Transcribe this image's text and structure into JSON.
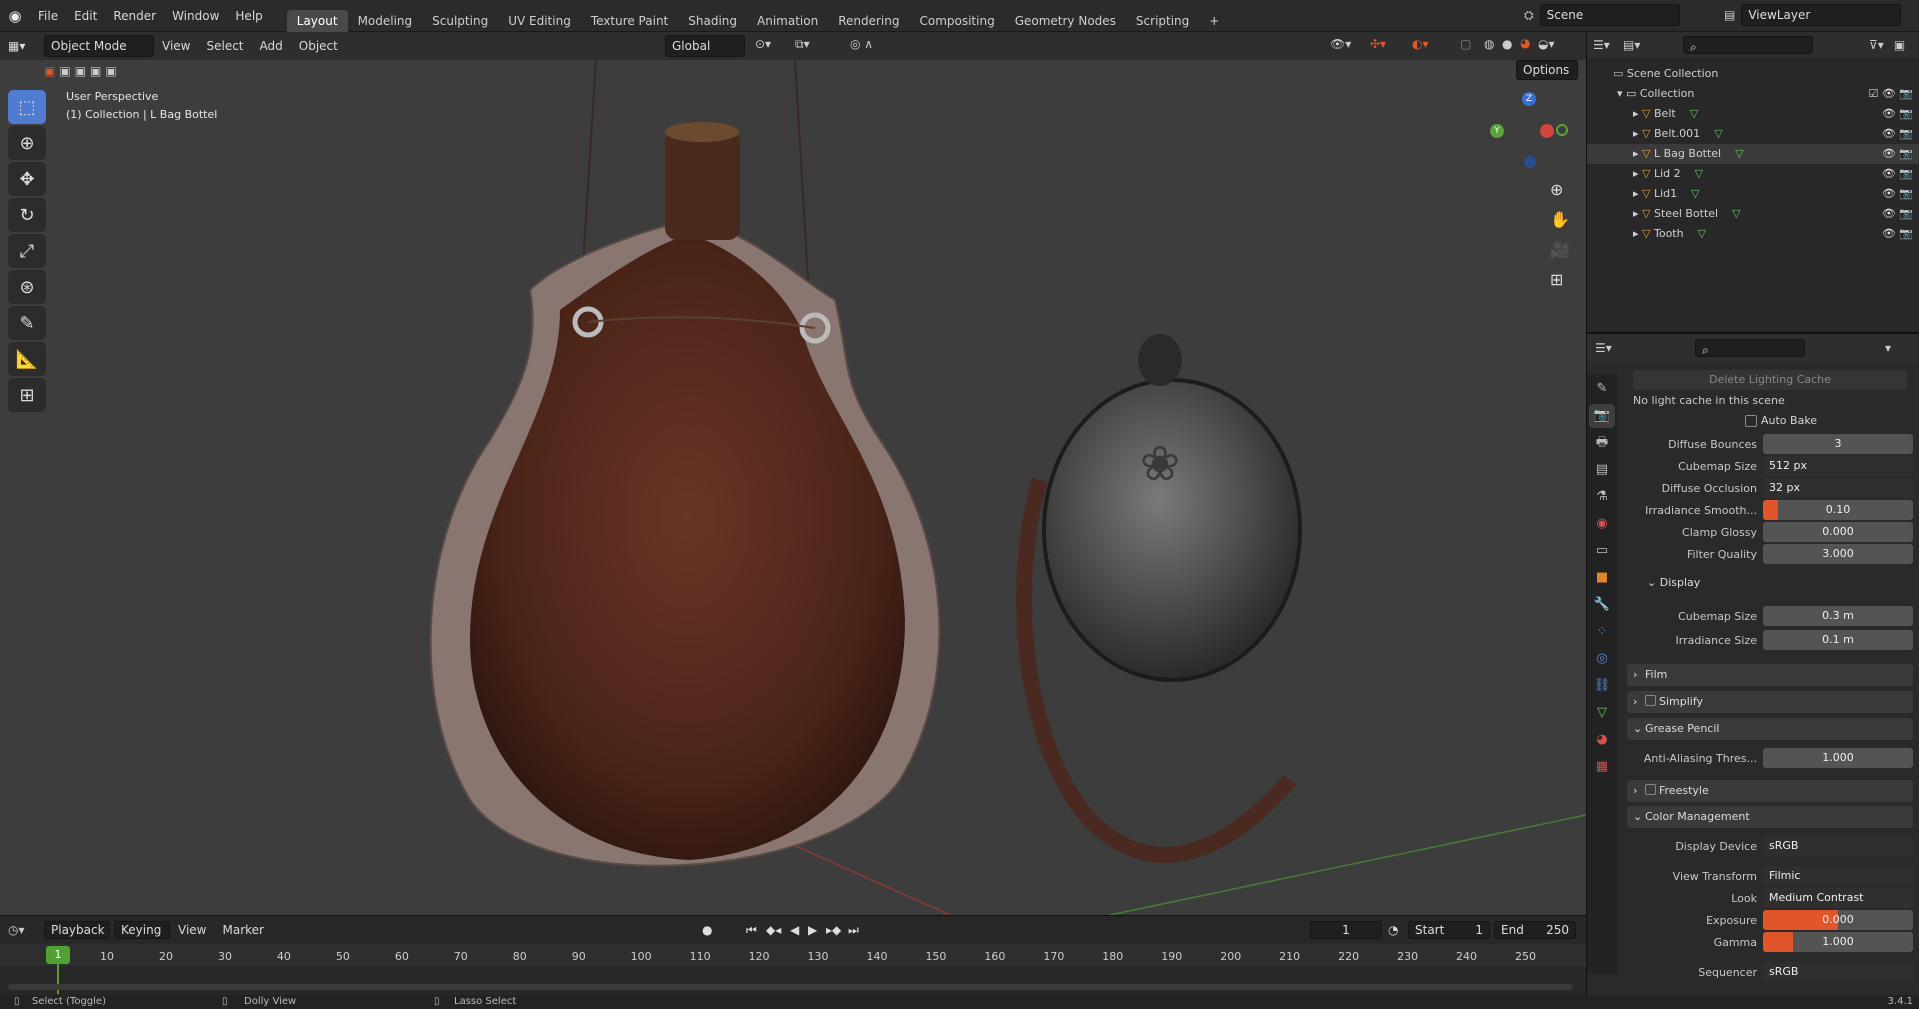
{
  "topbar": {
    "menus": [
      "File",
      "Edit",
      "Render",
      "Window",
      "Help"
    ],
    "workspaces": [
      "Layout",
      "Modeling",
      "Sculpting",
      "UV Editing",
      "Texture Paint",
      "Shading",
      "Animation",
      "Rendering",
      "Compositing",
      "Geometry Nodes",
      "Scripting"
    ],
    "active_workspace": "Layout",
    "scene": "Scene",
    "view_layer": "ViewLayer"
  },
  "viewport_header": {
    "mode": "Object Mode",
    "menus": [
      "View",
      "Select",
      "Add",
      "Object"
    ],
    "orientation": "Global",
    "options": "Options"
  },
  "viewport": {
    "perspective": "User Perspective",
    "collection_info": "(1) Collection | L Bag Bottel",
    "gizmo": {
      "z": "Z",
      "y": "Y"
    }
  },
  "outliner": {
    "root": "Scene Collection",
    "collection": "Collection",
    "items": [
      "Belt",
      "Belt.001",
      "L Bag Bottel",
      "Lid 2",
      "Lid1",
      "Steel Bottel",
      "Tooth"
    ]
  },
  "properties": {
    "delete_cache": "Delete Lighting Cache",
    "no_cache": "No light cache in this scene",
    "auto_bake": "Auto Bake",
    "fields": [
      {
        "label": "Diffuse Bounces",
        "value": "3"
      },
      {
        "label": "Cubemap Size",
        "value": "512 px"
      },
      {
        "label": "Diffuse Occlusion",
        "value": "32 px"
      },
      {
        "label": "Irradiance Smooth...",
        "value": "0.10"
      },
      {
        "label": "Clamp Glossy",
        "value": "0.000"
      },
      {
        "label": "Filter Quality",
        "value": "3.000"
      }
    ],
    "display_panel": "Display",
    "display_fields": [
      {
        "label": "Cubemap Size",
        "value": "0.3 m"
      },
      {
        "label": "Irradiance Size",
        "value": "0.1 m"
      }
    ],
    "film": "Film",
    "simplify": "Simplify",
    "grease_pencil": "Grease Pencil",
    "aa_label": "Anti-Aliasing Thres...",
    "aa_value": "1.000",
    "freestyle": "Freestyle",
    "color_management": "Color Management",
    "cm_fields": [
      {
        "label": "Display Device",
        "value": "sRGB"
      },
      {
        "label": "View Transform",
        "value": "Filmic"
      },
      {
        "label": "Look",
        "value": "Medium Contrast"
      },
      {
        "label": "Exposure",
        "value": "0.000"
      },
      {
        "label": "Gamma",
        "value": "1.000"
      },
      {
        "label": "Sequencer",
        "value": "sRGB"
      }
    ]
  },
  "timeline": {
    "menus": [
      "Playback",
      "Keying",
      "View",
      "Marker"
    ],
    "current_frame": "1",
    "start_label": "Start",
    "start": "1",
    "end_label": "End",
    "end": "250",
    "ticks": [
      "1",
      "10",
      "20",
      "30",
      "40",
      "50",
      "60",
      "70",
      "80",
      "90",
      "100",
      "110",
      "120",
      "130",
      "140",
      "150",
      "160",
      "170",
      "180",
      "190",
      "200",
      "210",
      "220",
      "230",
      "240",
      "250"
    ]
  },
  "statusbar": {
    "select": "Select (Toggle)",
    "dolly": "Dolly View",
    "lasso": "Lasso Select",
    "version": "3.4.1"
  },
  "colors": {
    "accent": "#e0562a",
    "selection": "#4f7bd1",
    "frame": "#4fa132"
  }
}
